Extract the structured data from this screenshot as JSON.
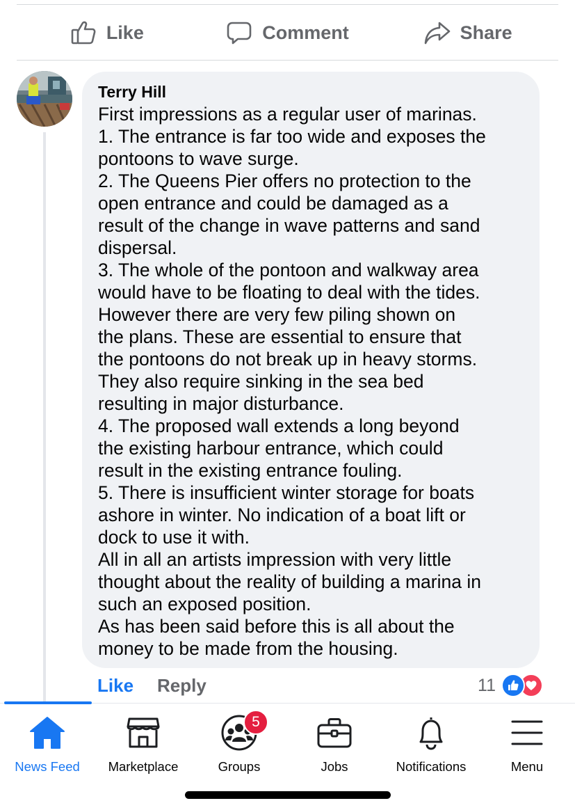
{
  "post_actions": {
    "like": "Like",
    "comment": "Comment",
    "share": "Share"
  },
  "comment": {
    "author": "Terry Hill",
    "lines": [
      "First impressions as a regular user of marinas.",
      "1. The entrance is far too wide and exposes the",
      "pontoons to wave surge.",
      "2. The Queens Pier offers no protection to the",
      "open entrance and could be damaged as a",
      "result of the change in wave patterns and sand",
      "dispersal.",
      "3. The whole of the pontoon and walkway area",
      "would have to be floating to deal with the tides.",
      "However there are very few piling  shown on",
      "the plans. These are essential to ensure that",
      "the pontoons do not break up in heavy storms.",
      "They also require sinking in the sea bed",
      "resulting in major disturbance.",
      "4. The proposed wall extends a long beyond",
      "the existing harbour entrance, which could",
      "result in the existing entrance fouling.",
      "5. There is insufficient winter storage for boats",
      "ashore in winter. No indication of a boat lift or",
      "dock to use it with.",
      "All in all an artists impression with very little",
      "thought about the reality of building a marina in",
      "such an exposed position.",
      "As has been said before this is all about the",
      "money to be made from the housing."
    ],
    "like_label": "Like",
    "reply_label": "Reply",
    "reaction_count": "11",
    "reactions": [
      "like-icon",
      "love-icon"
    ]
  },
  "tabbar": {
    "active": "news_feed",
    "accent_color": "#1877f2",
    "news_feed": "News Feed",
    "marketplace": "Marketplace",
    "groups": "Groups",
    "groups_badge": "5",
    "jobs": "Jobs",
    "notifications": "Notifications",
    "menu": "Menu"
  }
}
